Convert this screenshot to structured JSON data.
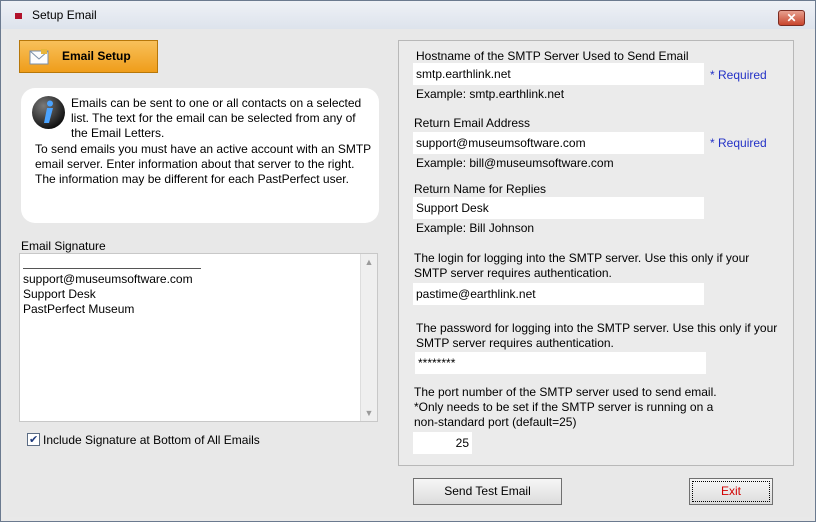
{
  "window": {
    "title": "Setup Email",
    "close_label": "✕"
  },
  "tab": {
    "label": "Email Setup",
    "icon": "envelope-icon"
  },
  "info": {
    "icon": "info-icon",
    "text1": "Emails can be sent to one or all contacts on a selected list.  The text for the email can be selected from any of the Email Letters.",
    "text2": "To send emails you must have an active account with an SMTP email server.  Enter information about that server to the right.  The information may be different for each PastPerfect user."
  },
  "signature": {
    "label": "Email Signature",
    "text": "support@museumsoftware.com\nSupport Desk\nPastPerfect Museum"
  },
  "include_signature": {
    "label": "Include Signature at Bottom of All Emails",
    "checked": true
  },
  "smtp": {
    "hostname_label": "Hostname of the SMTP Server Used to Send Email",
    "hostname_value": "smtp.earthlink.net",
    "hostname_example": "Example: smtp.earthlink.net",
    "return_label": "Return Email Address",
    "return_value": "support@museumsoftware.com",
    "return_example": "Example: bill@museumsoftware.com",
    "name_label": "Return Name for Replies",
    "name_value": "Support Desk",
    "name_example": "Example: Bill Johnson",
    "login_label": "The login for logging into the SMTP server. Use this only if your SMTP server requires authentication.",
    "login_value": "pastime@earthlink.net",
    "password_label": "The password for logging into the SMTP server. Use this only if your SMTP server requires authentication.",
    "password_value": "********",
    "port_label": "The port number of the SMTP server used to send email.",
    "port_note": " *Only needs to be set if the SMTP server is running on a non-standard port (default=25)",
    "port_value": "25",
    "required": "* Required"
  },
  "buttons": {
    "send_test": "Send Test Email",
    "exit": "Exit"
  },
  "colors": {
    "tab": "#f3a834",
    "required": "#2432c7",
    "exit_text": "#d10000",
    "title_icon": "#b1122b"
  }
}
